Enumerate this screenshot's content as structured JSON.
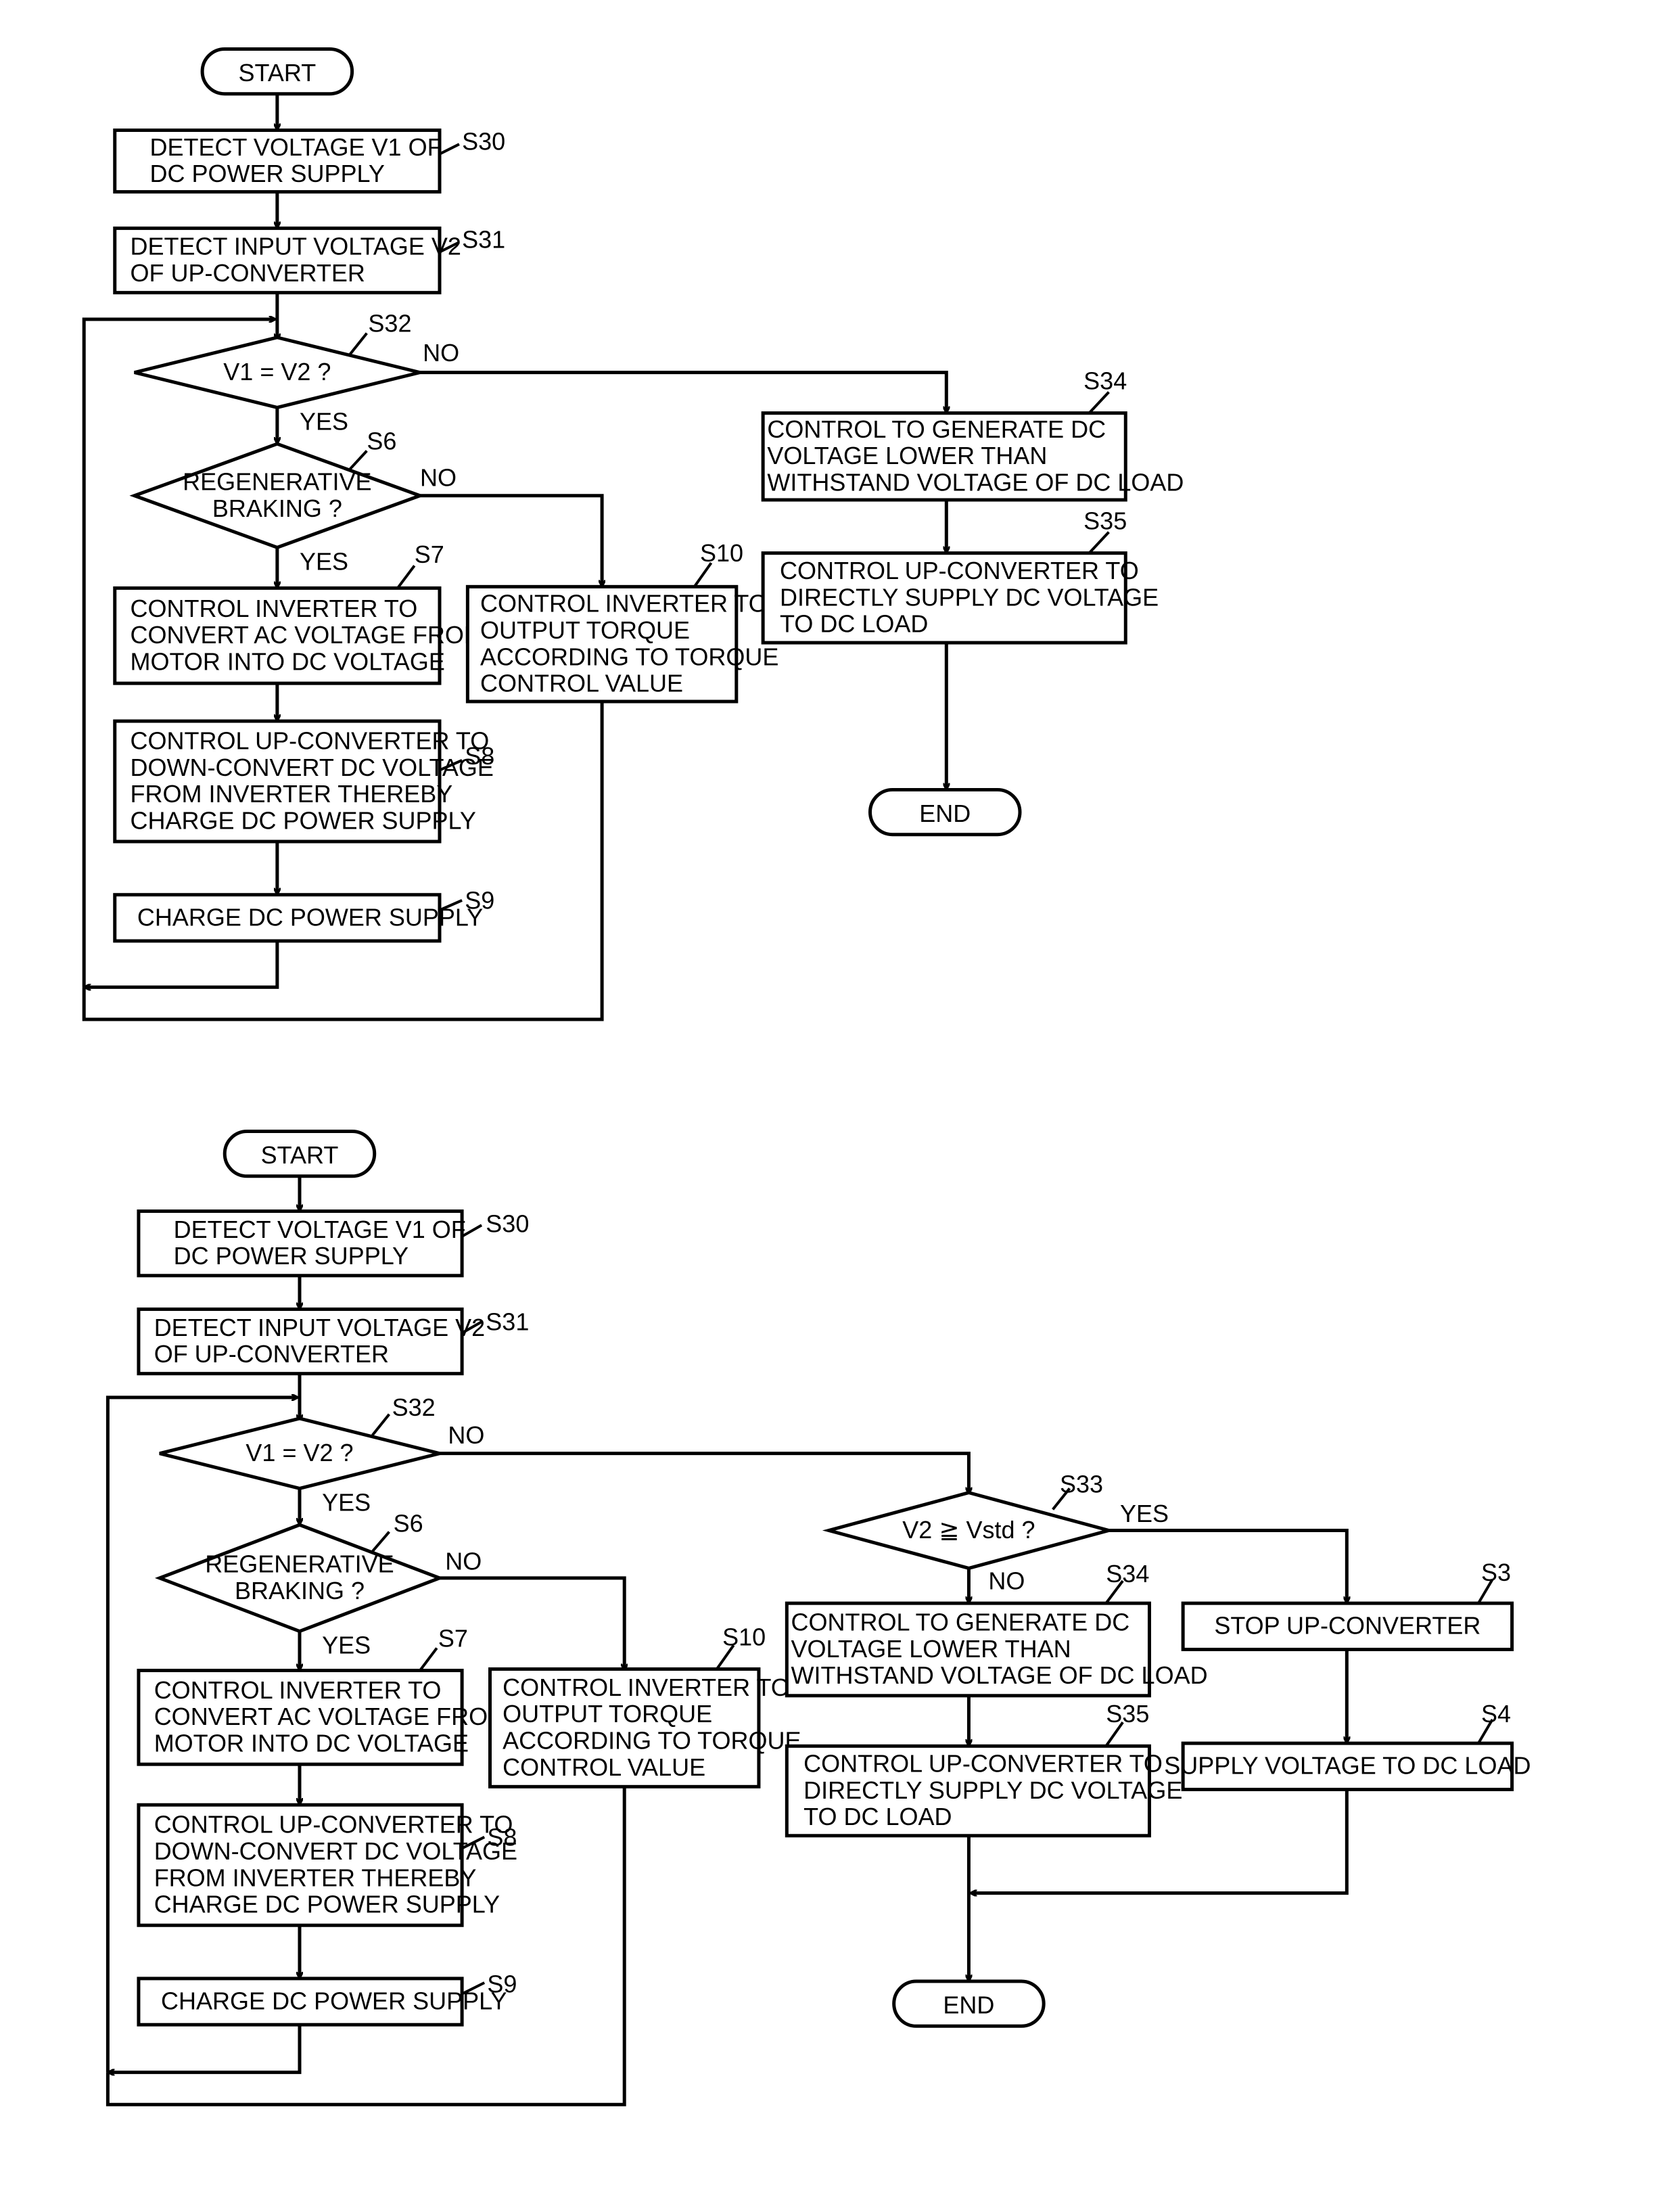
{
  "figures": [
    {
      "name": "flowchart-upper",
      "start": "START",
      "end": "END",
      "steps": {
        "S30": {
          "id": "S30",
          "lines": [
            "DETECT VOLTAGE V1 OF",
            "DC POWER SUPPLY"
          ]
        },
        "S31": {
          "id": "S31",
          "lines": [
            "DETECT INPUT VOLTAGE V2",
            "OF UP-CONVERTER"
          ]
        },
        "S32": {
          "id": "S32",
          "lines": [
            "V1 = V2 ?"
          ]
        },
        "S6": {
          "id": "S6",
          "lines": [
            "REGENERATIVE",
            "BRAKING ?"
          ]
        },
        "S7": {
          "id": "S7",
          "lines": [
            "CONTROL INVERTER TO",
            "CONVERT AC VOLTAGE FROM",
            "MOTOR INTO DC VOLTAGE"
          ]
        },
        "S8": {
          "id": "S8",
          "lines": [
            "CONTROL UP-CONVERTER TO",
            "DOWN-CONVERT DC VOLTAGE",
            "FROM INVERTER THEREBY",
            "CHARGE DC POWER SUPPLY"
          ]
        },
        "S9": {
          "id": "S9",
          "lines": [
            "CHARGE DC POWER SUPPLY"
          ]
        },
        "S10": {
          "id": "S10",
          "lines": [
            "CONTROL INVERTER TO",
            "OUTPUT TORQUE",
            "ACCORDING TO TORQUE",
            "CONTROL VALUE"
          ]
        },
        "S34": {
          "id": "S34",
          "lines": [
            "CONTROL TO GENERATE DC",
            "VOLTAGE LOWER THAN",
            "WITHSTAND VOLTAGE OF DC LOAD"
          ]
        },
        "S35": {
          "id": "S35",
          "lines": [
            "CONTROL UP-CONVERTER TO",
            "DIRECTLY SUPPLY DC VOLTAGE",
            "TO DC LOAD"
          ]
        }
      },
      "branch_labels": {
        "yes": "YES",
        "no": "NO"
      }
    },
    {
      "name": "flowchart-lower",
      "start": "START",
      "end": "END",
      "steps": {
        "S30": {
          "id": "S30",
          "lines": [
            "DETECT VOLTAGE V1 OF",
            "DC POWER SUPPLY"
          ]
        },
        "S31": {
          "id": "S31",
          "lines": [
            "DETECT INPUT VOLTAGE V2",
            "OF UP-CONVERTER"
          ]
        },
        "S32": {
          "id": "S32",
          "lines": [
            "V1 = V2 ?"
          ]
        },
        "S6": {
          "id": "S6",
          "lines": [
            "REGENERATIVE",
            "BRAKING ?"
          ]
        },
        "S7": {
          "id": "S7",
          "lines": [
            "CONTROL INVERTER TO",
            "CONVERT AC VOLTAGE FROM",
            "MOTOR INTO DC VOLTAGE"
          ]
        },
        "S8": {
          "id": "S8",
          "lines": [
            "CONTROL UP-CONVERTER TO",
            "DOWN-CONVERT DC VOLTAGE",
            "FROM INVERTER THEREBY",
            "CHARGE DC POWER SUPPLY"
          ]
        },
        "S9": {
          "id": "S9",
          "lines": [
            "CHARGE DC POWER SUPPLY"
          ]
        },
        "S10": {
          "id": "S10",
          "lines": [
            "CONTROL INVERTER TO",
            "OUTPUT TORQUE",
            "ACCORDING TO TORQUE",
            "CONTROL VALUE"
          ]
        },
        "S33": {
          "id": "S33",
          "lines": [
            "V2 ≧ Vstd ?"
          ]
        },
        "S34": {
          "id": "S34",
          "lines": [
            "CONTROL TO GENERATE DC",
            "VOLTAGE LOWER THAN",
            "WITHSTAND VOLTAGE OF DC LOAD"
          ]
        },
        "S35": {
          "id": "S35",
          "lines": [
            "CONTROL UP-CONVERTER TO",
            "DIRECTLY SUPPLY DC VOLTAGE",
            "TO DC LOAD"
          ]
        },
        "S3": {
          "id": "S3",
          "lines": [
            "STOP UP-CONVERTER"
          ]
        },
        "S4": {
          "id": "S4",
          "lines": [
            "SUPPLY VOLTAGE TO DC LOAD"
          ]
        }
      },
      "branch_labels": {
        "yes": "YES",
        "no": "NO"
      }
    }
  ]
}
